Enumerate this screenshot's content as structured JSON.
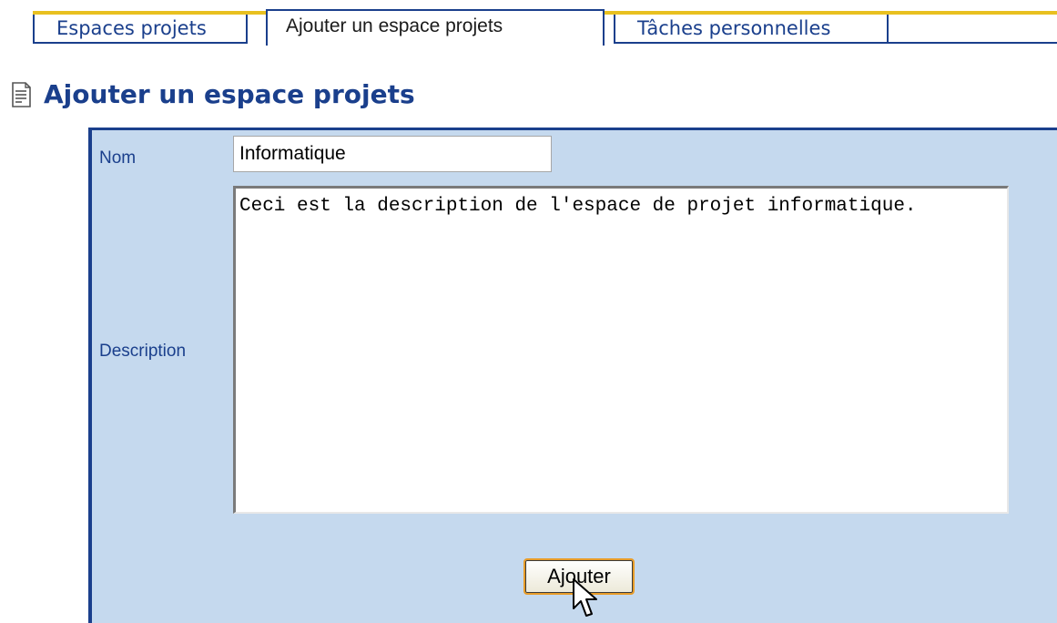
{
  "tabs": [
    {
      "label": "Espaces projets",
      "active": false
    },
    {
      "label": "Ajouter un espace projets",
      "active": true
    },
    {
      "label": "Tâches personnelles",
      "active": false
    }
  ],
  "page": {
    "icon": "document-icon",
    "title": "Ajouter un espace projets"
  },
  "form": {
    "nom_label": "Nom",
    "nom_value": "Informatique",
    "description_label": "Description",
    "description_value": "Ceci est la description de l'espace de projet informatique.",
    "submit_label": "Ajouter"
  },
  "colors": {
    "tab_accent": "#e8c020",
    "primary_blue": "#1a3f8c",
    "panel_background": "#c5d9ee",
    "button_border": "#e89c28"
  }
}
